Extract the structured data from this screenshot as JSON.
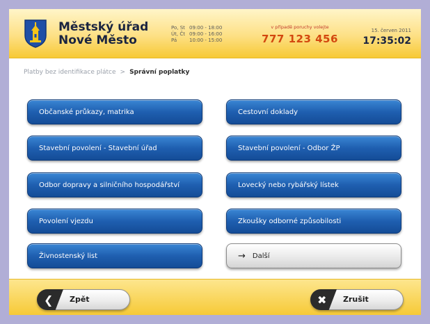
{
  "header": {
    "office_line1": "Městský úřad",
    "office_line2": "Nové Město",
    "hours": [
      {
        "days": "Po, St",
        "time": "09:00  -  18:00"
      },
      {
        "days": "Út, Čt",
        "time": "09:00  -  16:00"
      },
      {
        "days": "Pá",
        "time": "10:00  -  15:00"
      }
    ],
    "hotline_label": "v případě poruchy volejte",
    "hotline_number": "777 123 456",
    "date": "15. červen 2011",
    "time": "17:35:02"
  },
  "breadcrumb": {
    "parent": "Platby bez identifikace plátce",
    "separator": ">",
    "current": "Správní poplatky"
  },
  "menu": {
    "left": [
      "Občanské průkazy, matrika",
      "Stavební povolení - Stavební úřad",
      "Odbor dopravy a silničního hospodářství",
      "Povolení vjezdu",
      "Živnostenský list"
    ],
    "right": [
      "Cestovní doklady",
      "Stavební povolení - Odbor ŽP",
      "Lovecký nebo rybářský lístek",
      "Zkoušky odborné způsobilosti"
    ],
    "next_label": "Další",
    "next_icon": "→"
  },
  "footer": {
    "back_label": "Zpět",
    "back_icon": "❮",
    "cancel_label": "Zrušit",
    "cancel_icon": "✖"
  },
  "colors": {
    "button_blue": "#1f5fb0",
    "header_yellow": "#fde085",
    "frame_lilac": "#b1aed6"
  }
}
